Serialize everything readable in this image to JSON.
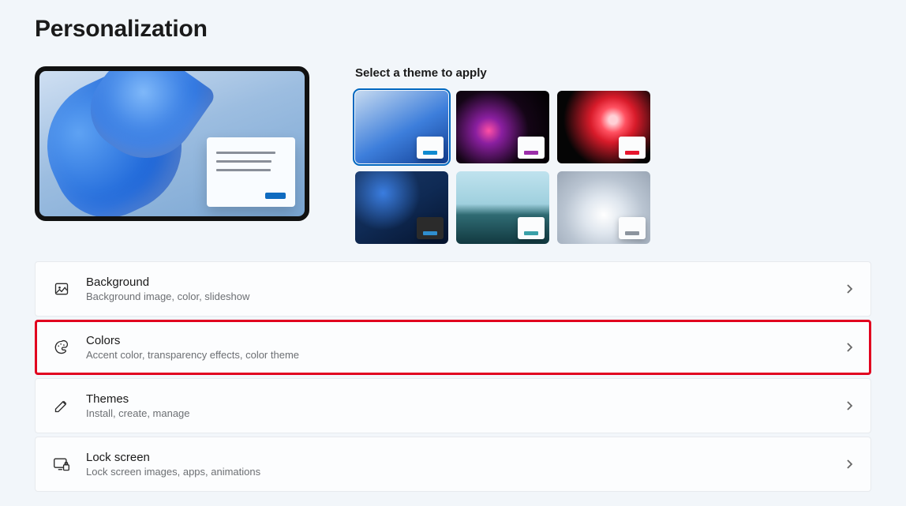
{
  "page": {
    "title": "Personalization",
    "themes_heading": "Select a theme to apply"
  },
  "themes": [
    {
      "name": "windows-light",
      "accent": "#0f8ad0",
      "dark_window": false,
      "selected": true
    },
    {
      "name": "dark-purple",
      "accent": "#9b2ea9",
      "dark_window": false,
      "selected": false
    },
    {
      "name": "dark-red",
      "accent": "#e7152d",
      "dark_window": false,
      "selected": false
    },
    {
      "name": "windows-dark",
      "accent": "#2f8ecf",
      "dark_window": true,
      "selected": false
    },
    {
      "name": "horizon",
      "accent": "#3aa0a8",
      "dark_window": false,
      "selected": false
    },
    {
      "name": "gray-swirl",
      "accent": "#8c949e",
      "dark_window": false,
      "selected": false
    }
  ],
  "preview_accent": "#0f6bc0",
  "settings": [
    {
      "key": "background",
      "title": "Background",
      "subtitle": "Background image, color, slideshow",
      "highlight": false
    },
    {
      "key": "colors",
      "title": "Colors",
      "subtitle": "Accent color, transparency effects, color theme",
      "highlight": true
    },
    {
      "key": "themes",
      "title": "Themes",
      "subtitle": "Install, create, manage",
      "highlight": false
    },
    {
      "key": "lockscreen",
      "title": "Lock screen",
      "subtitle": "Lock screen images, apps, animations",
      "highlight": false
    }
  ]
}
